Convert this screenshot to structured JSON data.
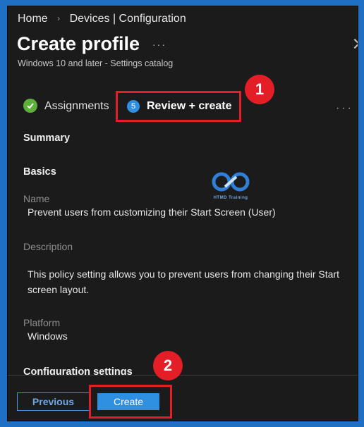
{
  "breadcrumb": {
    "home": "Home",
    "separator": "›",
    "current": "Devices | Configuration"
  },
  "page": {
    "title": "Create profile",
    "more": "···",
    "subtitle": "Windows 10 and later - Settings catalog"
  },
  "steps": [
    {
      "label": "Assignments",
      "status": "completed",
      "icon": "check-icon"
    },
    {
      "number": "5",
      "label": "Review + create",
      "status": "current"
    }
  ],
  "steps_more": "···",
  "summary": {
    "heading": "Summary",
    "basics_heading": "Basics",
    "name_label": "Name",
    "name_value": "Prevent users from customizing their Start Screen (User)",
    "description_label": "Description",
    "description_value": "This policy setting allows you to prevent users from changing their Start screen layout.",
    "platform_label": "Platform",
    "platform_value": "Windows",
    "config_heading": "Configuration settings"
  },
  "watermark": {
    "text": "HTMD Training"
  },
  "annotations": {
    "badge_1": "1",
    "badge_2": "2"
  },
  "buttons": {
    "previous": "Previous",
    "create": "Create"
  },
  "colors": {
    "accent": "#2f8fe0",
    "highlight": "#e41e26",
    "success": "#5db03a",
    "background": "#1b1b1b",
    "frame": "#1f6fc4"
  }
}
